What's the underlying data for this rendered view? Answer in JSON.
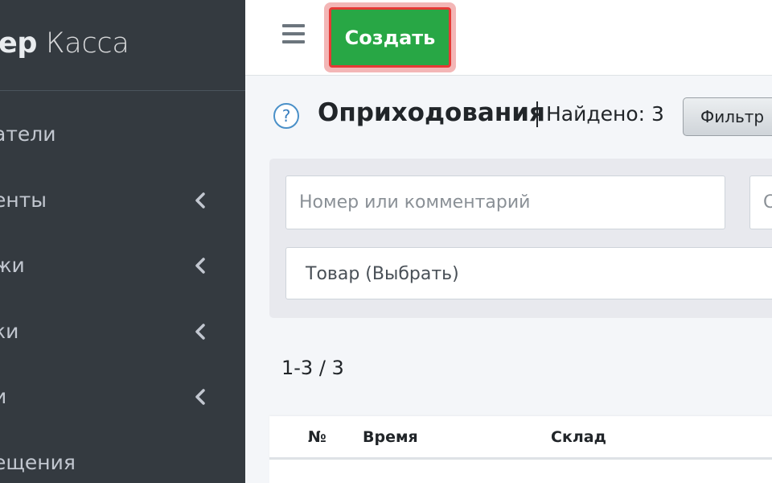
{
  "sidebar": {
    "brand_bold": "тер",
    "brand_light": "Касса",
    "items": [
      {
        "label": "атели",
        "has_children": false
      },
      {
        "label": "енты",
        "has_children": true
      },
      {
        "label": "жи",
        "has_children": true
      },
      {
        "label": "ки",
        "has_children": true
      },
      {
        "label": "и",
        "has_children": true
      },
      {
        "label": "ещения",
        "has_children": false
      }
    ]
  },
  "toolbar": {
    "create_label": "Создать"
  },
  "page": {
    "title": "Оприходования",
    "found": "Найдено: 3",
    "filter_label": "Фильтр"
  },
  "filters": {
    "search_placeholder": "Номер или комментарий",
    "second_placeholder": "С",
    "product_label": "Товар (Выбрать)"
  },
  "pagination": {
    "range": "1-3 / 3"
  },
  "table": {
    "columns": [
      "№",
      "Время",
      "Склад"
    ]
  },
  "colors": {
    "sidebar_bg": "#343a40",
    "create_button": "#28a745",
    "highlight": "#e53935"
  },
  "icons": {
    "menu": "hamburger-icon",
    "help": "question-circle-icon",
    "chevron": "chevron-left-icon"
  }
}
